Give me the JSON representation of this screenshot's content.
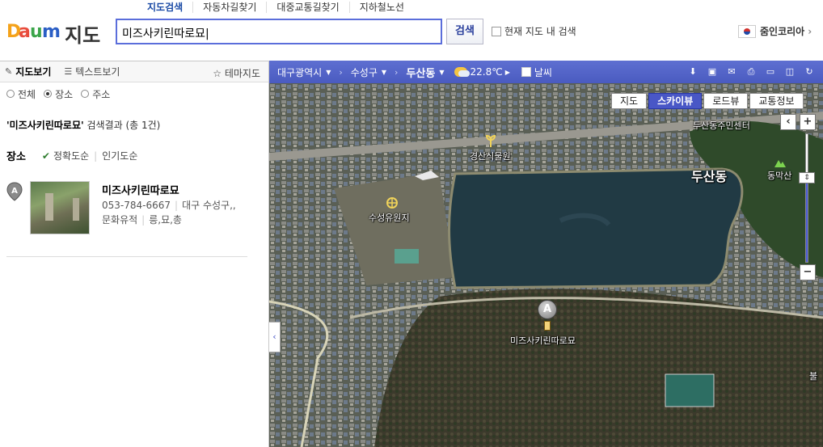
{
  "header": {
    "logo_daum": "Daum",
    "logo_map": "지도",
    "nav": [
      "지도검색",
      "자동차길찾기",
      "대중교통길찾기",
      "지하철노선"
    ],
    "search_value": "미즈사키린따로묘|",
    "search_button": "검색",
    "within_map_label": "현재 지도 내 검색",
    "zoom_in_korea": "줌인코리아"
  },
  "left_panel": {
    "tabs": {
      "map_view": "지도보기",
      "text_view": "텍스트보기",
      "theme_map": "테마지도"
    },
    "filters": [
      "전체",
      "장소",
      "주소"
    ],
    "filter_selected": "장소",
    "result_query": "'미즈사키린따로묘'",
    "result_suffix": "검색결과 (총 1건)",
    "sort_label": "장소",
    "sort_accuracy": "정확도순",
    "sort_popularity": "인기도순",
    "result": {
      "marker": "A",
      "name": "미즈사키린따로묘",
      "phone": "053-784-6667",
      "address": "대구 수성구,,",
      "category": "문화유적",
      "subcategory": "릉,묘,총"
    }
  },
  "map": {
    "breadcrumbs": [
      "대구광역시",
      "수성구",
      "두산동"
    ],
    "temperature": "22.8℃",
    "weather_label": "날씨",
    "map_types": [
      "지도",
      "스카이뷰",
      "로드뷰",
      "교통정보"
    ],
    "active_map_type": "스카이뷰",
    "labels": {
      "community_center": "두산동주민센터",
      "botanical_garden": "경산식물원",
      "amusement_park": "수성유원지",
      "dong_name": "두산동",
      "mountain": "동막산",
      "marker_label": "미즈사키린따로묘",
      "edge_label": "불"
    },
    "marker": "A",
    "colors": {
      "toolbar": "#4a5bc0",
      "active_tab": "#4957c6",
      "water": "#213a44"
    }
  }
}
